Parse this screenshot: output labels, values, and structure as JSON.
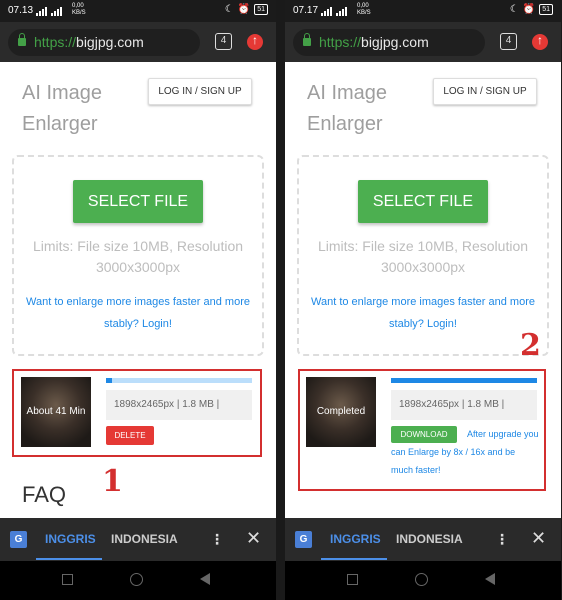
{
  "screens": [
    {
      "status": {
        "time": "07.13",
        "net_speed": "0,00\nKB/S",
        "battery": "51"
      },
      "browser": {
        "url_scheme": "https://",
        "url_host": "bigjpg.com",
        "tab_count": "4"
      },
      "site": {
        "title": "AI Image Enlarger",
        "login_label": "LOG IN / SIGN UP"
      },
      "upload": {
        "select_label": "SELECT FILE",
        "limits": "Limits: File size 10MB, Resolution 3000x3000px",
        "login_prompt": "Want to enlarge more images faster and more stably? Login!"
      },
      "task": {
        "thumb_label": "About 41 Min",
        "progress": 0.04,
        "info": "1898x2465px | 1.8 MB |",
        "action_label": "DELETE"
      },
      "faq_title": "FAQ",
      "annotation_number": "1",
      "translate": {
        "lang_active": "INGGRIS",
        "lang_other": "INDONESIA"
      }
    },
    {
      "status": {
        "time": "07.17",
        "net_speed": "0,00\nKB/S",
        "battery": "51"
      },
      "browser": {
        "url_scheme": "https://",
        "url_host": "bigjpg.com",
        "tab_count": "4"
      },
      "site": {
        "title": "AI Image Enlarger",
        "login_label": "LOG IN / SIGN UP"
      },
      "upload": {
        "select_label": "SELECT FILE",
        "limits": "Limits: File size 10MB, Resolution 3000x3000px",
        "login_prompt": "Want to enlarge more images faster and more stably? Login!"
      },
      "task": {
        "thumb_label": "Completed",
        "progress": 1.0,
        "info": "1898x2465px | 1.8 MB |",
        "action_label": "DOWNLOAD",
        "upgrade_text": "After upgrade you can Enlarge by 8x / 16x and be much faster!"
      },
      "annotation_number": "2",
      "translate": {
        "lang_active": "INGGRIS",
        "lang_other": "INDONESIA"
      }
    }
  ]
}
